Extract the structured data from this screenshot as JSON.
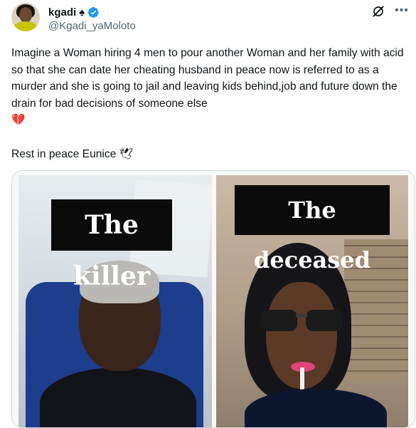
{
  "author": {
    "display_name": "kgadi",
    "name_suffix_emoji": "♠",
    "handle": "@Kgadi_yaMoloto",
    "verified": true,
    "accent_color": "#1d9bf0"
  },
  "actions": {
    "grok_icon": "grok-icon",
    "more_icon": "more-icon"
  },
  "tweet": {
    "paragraph_1": "Imagine a Woman hiring 4 men to pour another Woman and her family with acid so that she can date her cheating husband in peace now is referred to as a murder and  she is going to jail and leaving kids behind,job and future down the drain for bad decisions of someone else",
    "emoji_1": "💔",
    "paragraph_2": "Rest in peace Eunice",
    "emoji_2": "🕊"
  },
  "media": {
    "left_label": "The killer",
    "right_label": "The deceased"
  }
}
